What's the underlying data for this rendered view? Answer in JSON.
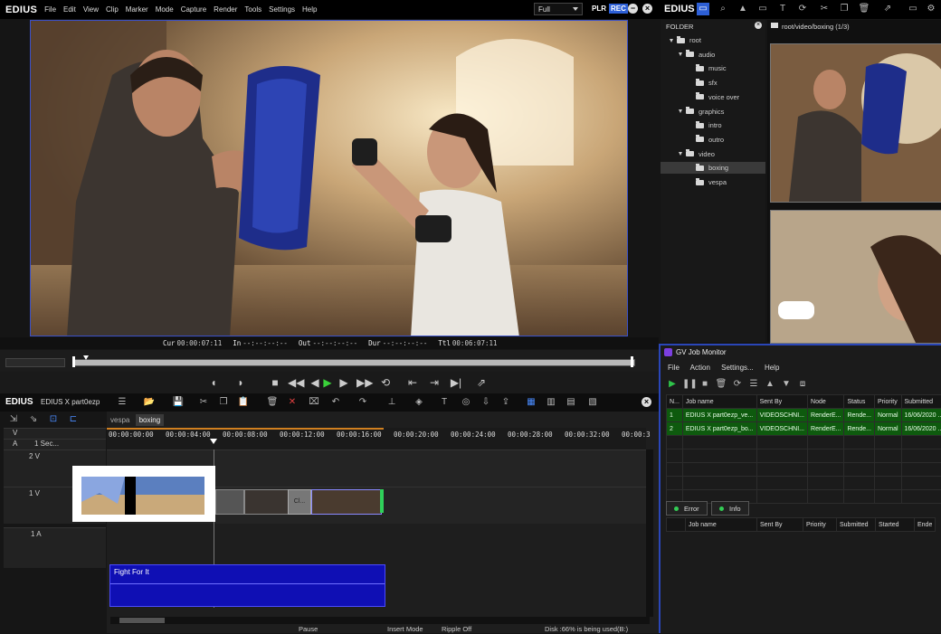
{
  "app": {
    "logo": "EDIUS",
    "menu": [
      "File",
      "Edit",
      "View",
      "Clip",
      "Marker",
      "Mode",
      "Capture",
      "Render",
      "Tools",
      "Settings",
      "Help"
    ],
    "mode_select": "Full",
    "plr": "PLR",
    "rec": "REC"
  },
  "timecodes": {
    "cur_label": "Cur",
    "cur": "00:00:07:11",
    "in_label": "In",
    "in": "--:--:--:--",
    "out_label": "Out",
    "out": "--:--:--:--",
    "dur_label": "Dur",
    "dur": "--:--:--:--",
    "ttl_label": "Ttl",
    "ttl": "00:06:07:11"
  },
  "timeline": {
    "logo": "EDIUS",
    "project": "EDIUS X part0ezp",
    "sequence_tabs": [
      "vespa",
      "boxing"
    ],
    "active_tab": "boxing",
    "zoom": "1 Sec...",
    "ruler": [
      "00:00:00:00",
      "00:00:04:00",
      "00:00:08:00",
      "00:00:12:00",
      "00:00:16:00",
      "00:00:20:00",
      "00:00:24:00",
      "00:00:28:00",
      "00:00:32:00",
      "00:00:3"
    ],
    "tracks": {
      "v_header": "V",
      "a_header": "A",
      "t2v": "2 V",
      "t1v": "1 V",
      "t1a": "1 A"
    },
    "clip_label": "Cl...",
    "audio_clip": "Fight For It",
    "status": {
      "pause": "Pause",
      "insert": "Insert Mode",
      "ripple": "Ripple Off",
      "disk": "Disk :66% is being used(B:)"
    }
  },
  "bin": {
    "logo": "EDIUS",
    "folder_title": "FOLDER",
    "path": "root/video/boxing (1/3)",
    "folders": [
      {
        "label": "root",
        "level": 0,
        "expanded": true
      },
      {
        "label": "audio",
        "level": 1,
        "expanded": true
      },
      {
        "label": "music",
        "level": 2
      },
      {
        "label": "sfx",
        "level": 2
      },
      {
        "label": "voice over",
        "level": 2
      },
      {
        "label": "graphics",
        "level": 1,
        "expanded": true
      },
      {
        "label": "intro",
        "level": 2
      },
      {
        "label": "outro",
        "level": 2
      },
      {
        "label": "video",
        "level": 1,
        "expanded": true
      },
      {
        "label": "boxing",
        "level": 2,
        "selected": true
      },
      {
        "label": "vespa",
        "level": 2
      }
    ]
  },
  "job_monitor": {
    "title": "GV Job Monitor",
    "menu": [
      "File",
      "Action",
      "Settings...",
      "Help"
    ],
    "columns": [
      "N...",
      "Job name",
      "Sent By",
      "Node",
      "Status",
      "Priority",
      "Submitted"
    ],
    "jobs": [
      [
        "1",
        "EDIUS X part0ezp_ve...",
        "VIDEOSCHNI...",
        "RenderE...",
        "Rende...",
        "Normal",
        "16/06/2020 ..."
      ],
      [
        "2",
        "EDIUS X part0ezp_bo...",
        "VIDEOSCHNI...",
        "RenderE...",
        "Rende...",
        "Normal",
        "16/06/2020 ..."
      ]
    ],
    "tabs": [
      "Error",
      "Info"
    ],
    "log_columns": [
      "Job name",
      "Sent By",
      "Priority",
      "Submitted",
      "Started",
      "Ende"
    ]
  },
  "colors": {
    "accent": "#2d5fd6",
    "job_row": "#0e5a0e",
    "audio_clip": "#0f0fb4"
  }
}
